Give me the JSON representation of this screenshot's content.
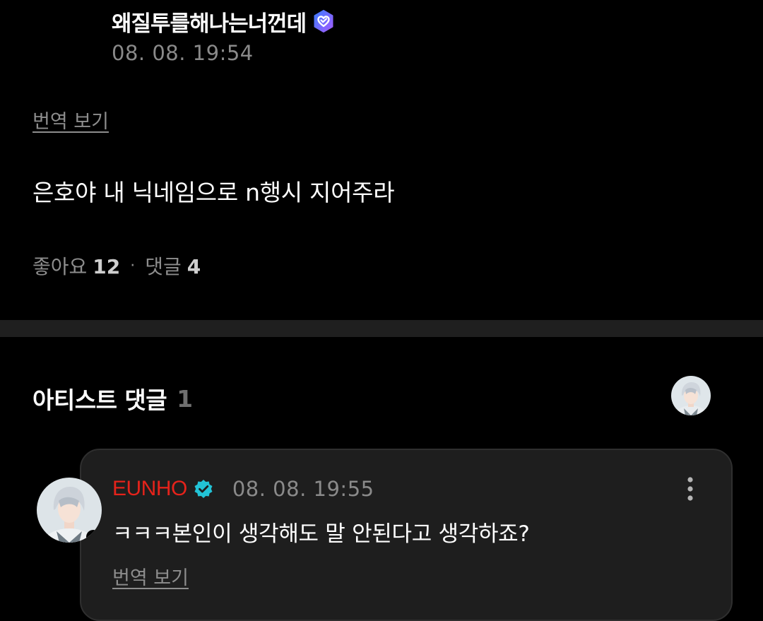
{
  "post": {
    "author": "왜질투를해나는너껀데",
    "time": "08. 08. 19:54",
    "translate_label": "번역 보기",
    "body": "은호야 내 닉네임으로 n행시 지어주라",
    "likes_label": "좋아요",
    "likes_count": "12",
    "separator": "·",
    "comments_label": "댓글",
    "comments_count": "4"
  },
  "artist_comments": {
    "title": "아티스트 댓글",
    "count": "1"
  },
  "comment": {
    "author": "EUNHO",
    "time": "08. 08. 19:55",
    "text": "ㅋㅋㅋ본인이 생각해도 말 안된다고 생각하죠?",
    "translate_label": "번역 보기"
  },
  "colors": {
    "background": "#000000",
    "artist_name": "#e5231b",
    "badge_gradient_start": "#3d7bff",
    "badge_gradient_end": "#a25cff",
    "artist_check": "#22c3d6"
  },
  "icons": {
    "post_badge": "fan-verified-heart-icon",
    "artist_badge": "artist-verified-check-icon",
    "more": "more-vertical-icon"
  }
}
